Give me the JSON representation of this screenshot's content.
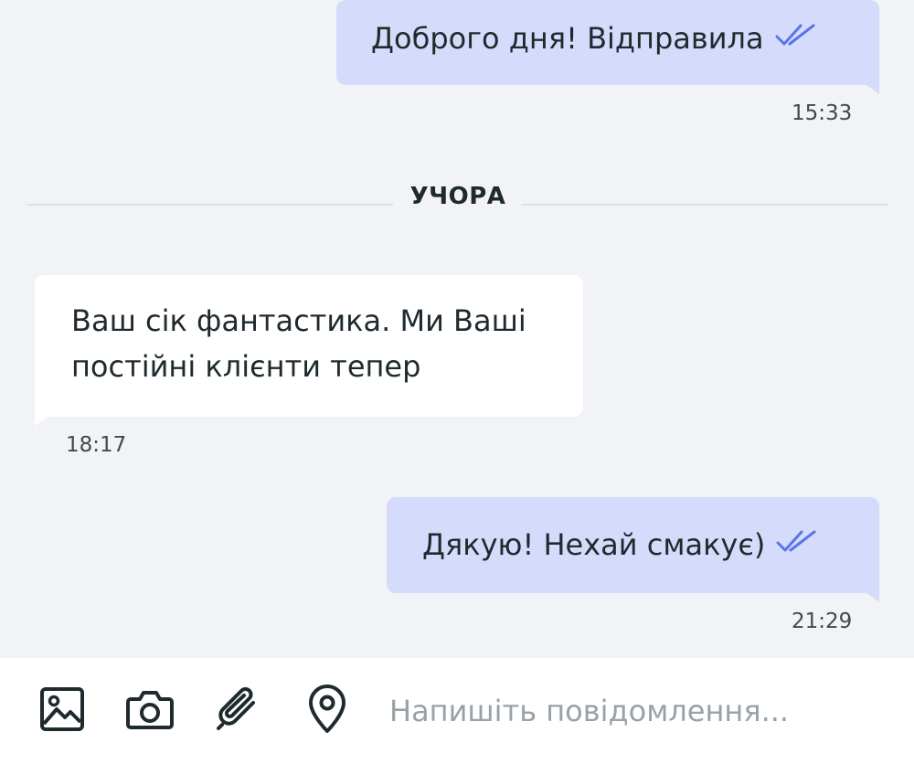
{
  "messages": [
    {
      "direction": "out",
      "text": "Доброго дня! Відправила",
      "time": "15:33",
      "read": true
    },
    {
      "direction": "in",
      "text": "Ваш сік фантастика. Ми Ваші постійні клієнти тепер",
      "time": "18:17"
    },
    {
      "direction": "out",
      "text": "Дякую! Нехай смакує)",
      "time": "21:29",
      "read": true
    }
  ],
  "date_divider": "УЧОРА",
  "composer": {
    "placeholder": "Напишіть повідомлення...",
    "value": "",
    "tools": [
      "image-icon",
      "camera-icon",
      "paperclip-icon",
      "location-pin-icon"
    ]
  },
  "colors": {
    "background": "#f2f3f6",
    "outgoing_bubble": "#d5dcfb",
    "incoming_bubble": "#ffffff",
    "read_ticks": "#5b73e8",
    "text": "#1f2a2e"
  }
}
